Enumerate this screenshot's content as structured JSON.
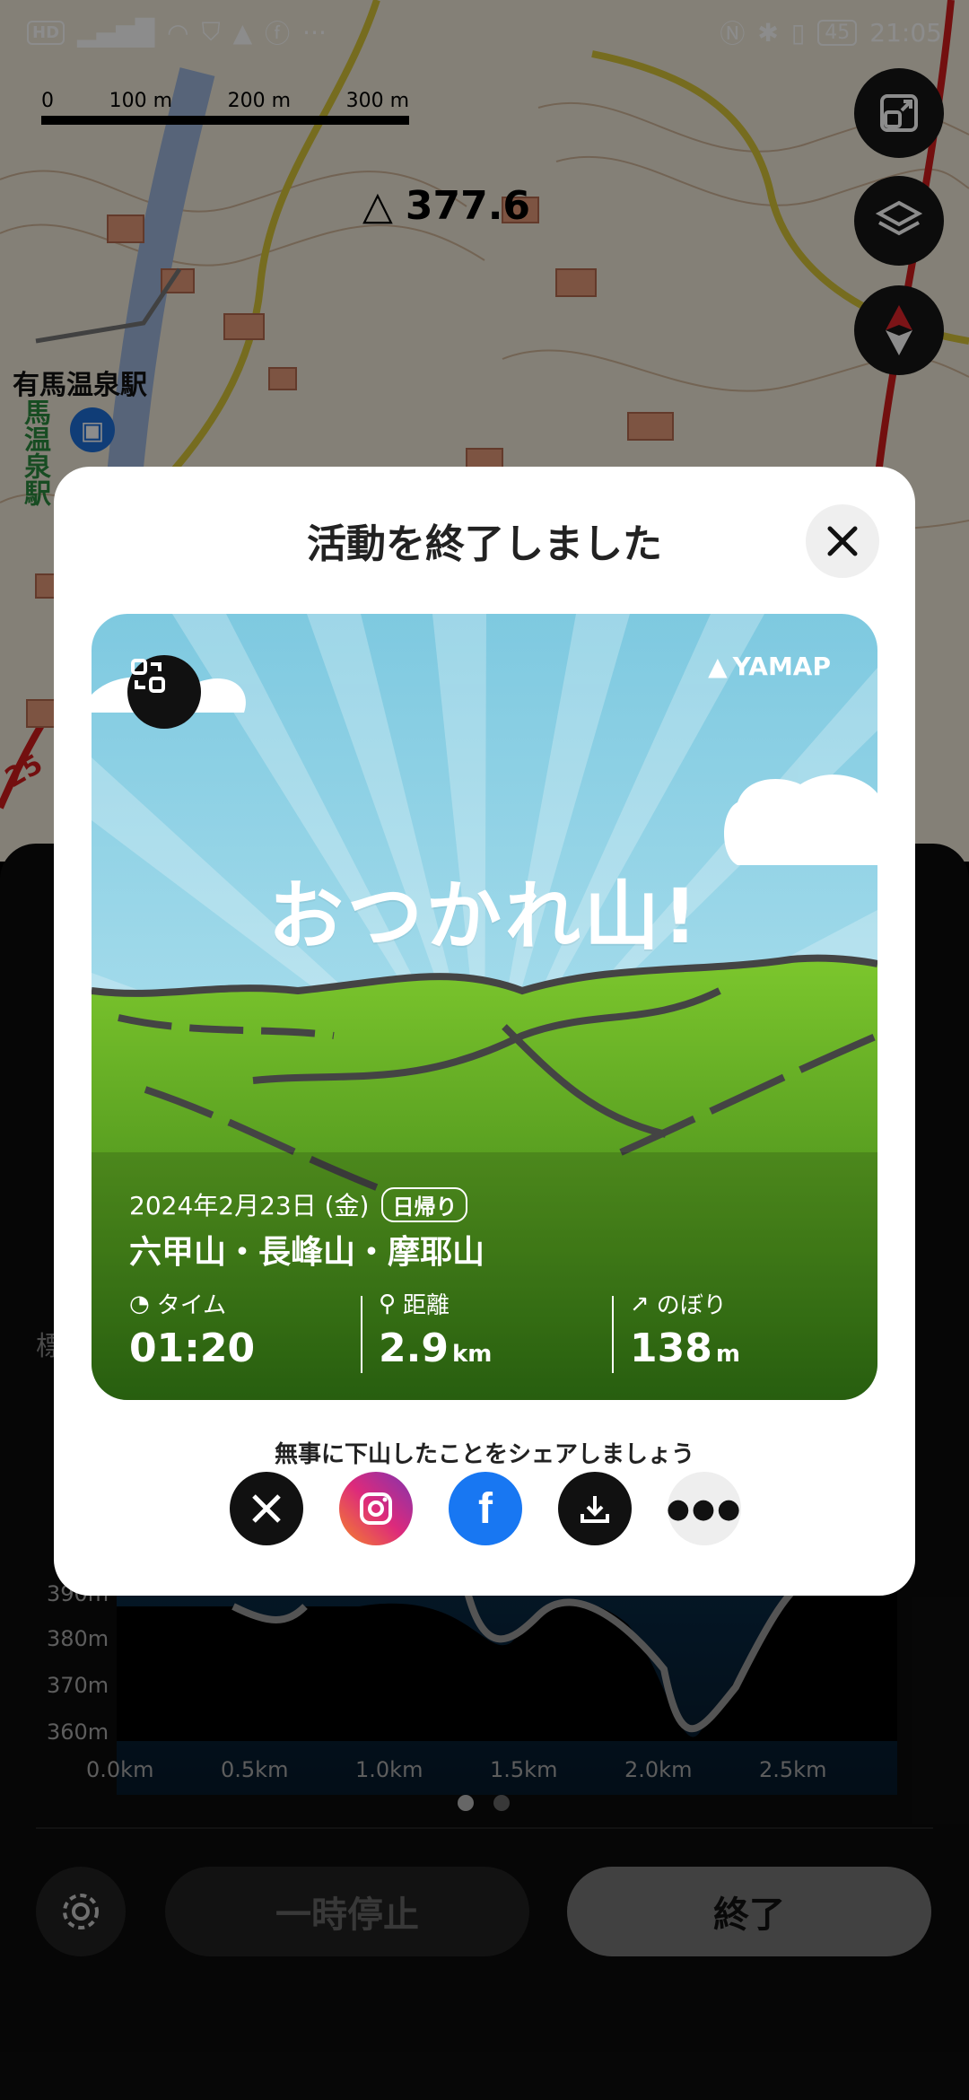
{
  "status_bar": {
    "left": "HD",
    "time": "21:05",
    "battery": "45"
  },
  "map": {
    "scale": [
      "0",
      "100 m",
      "200 m",
      "300 m"
    ],
    "summit": "377.6",
    "station": "有馬温泉駅",
    "station_vertical": "馬温泉駅",
    "route_number": "25"
  },
  "elevation": {
    "y_labels": [
      "390m",
      "380m",
      "370m",
      "360m"
    ],
    "x_labels": [
      "0.0km",
      "0.5km",
      "1.0km",
      "1.5km",
      "2.0km",
      "2.5km"
    ],
    "left_label": "標"
  },
  "buttons": {
    "pause": "一時停止",
    "finish": "終了"
  },
  "modal": {
    "title": "活動を終了しました",
    "brand": "YAMAP",
    "headline": "おつかれ山!",
    "date": "2024年2月23日 (金)",
    "trip_type": "日帰り",
    "mountains": "六甲山・長峰山・摩耶山",
    "stats": {
      "time_label": "タイム",
      "time": "01:20",
      "distance_label": "距離",
      "distance": "2.9",
      "distance_unit": "km",
      "climb_label": "のぼり",
      "climb": "138",
      "climb_unit": "m"
    },
    "share_message": "無事に下山したことをシェアしましょう"
  },
  "colors": {
    "sky_top": "#7ec9e0",
    "grass": "#5ca62a",
    "instagram": "#d62976",
    "facebook": "#1877f2"
  }
}
